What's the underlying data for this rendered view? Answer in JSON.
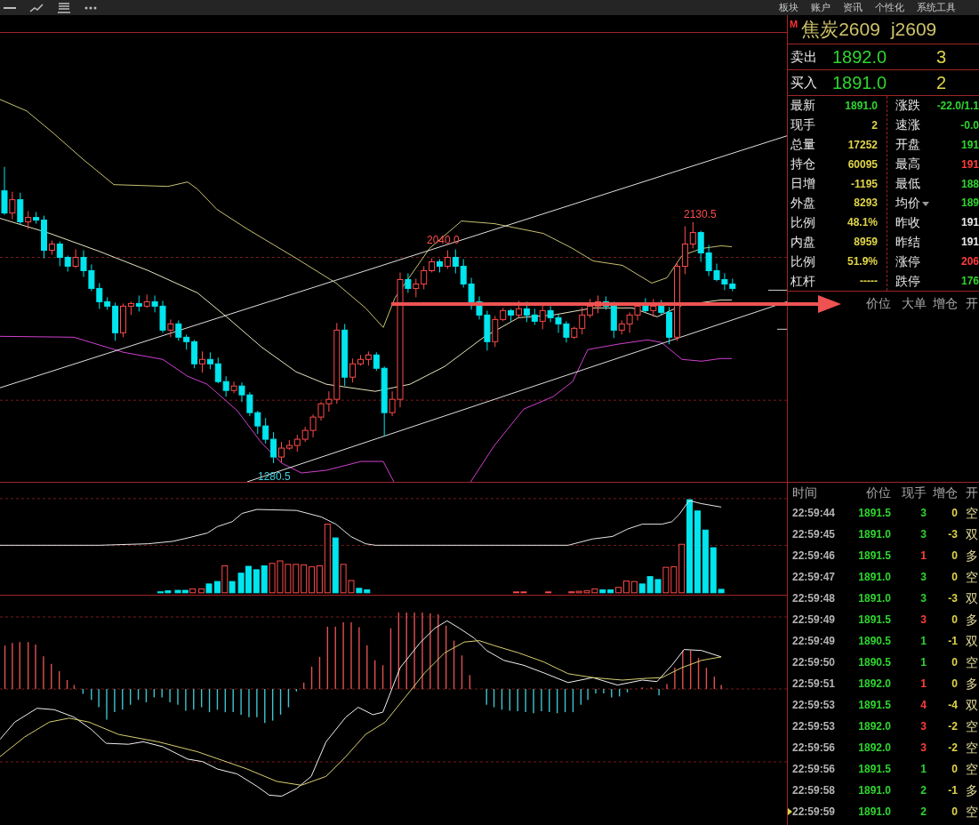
{
  "toolbar": {
    "menu_items": [
      "板块",
      "账户",
      "资讯",
      "个性化",
      "系统工具"
    ]
  },
  "chart": {
    "price_labels": [
      {
        "text": "2130.5",
        "color": "#ff4d4d"
      },
      {
        "text": "2040.0",
        "color": "#ff4d4d"
      },
      {
        "text": "1280.5",
        "color": "#3fd0dc"
      }
    ]
  },
  "quote": {
    "badge": "M",
    "name": "焦炭2609",
    "code": "j2609",
    "ask": {
      "label": "卖出",
      "price": "1892.0",
      "volume": "3"
    },
    "bid": {
      "label": "买入",
      "price": "1891.0",
      "volume": "2"
    }
  },
  "stats": {
    "left": [
      {
        "label": "最新",
        "value": "1891.0",
        "color": "#2fd52f"
      },
      {
        "label": "现手",
        "value": "2",
        "color": "#e0d448"
      },
      {
        "label": "总量",
        "value": "17252",
        "color": "#e0d448"
      },
      {
        "label": "持仓",
        "value": "60095",
        "color": "#e0d448"
      },
      {
        "label": "日增",
        "value": "-1195",
        "color": "#e0d448"
      },
      {
        "label": "外盘",
        "value": "8293",
        "color": "#e0d448"
      },
      {
        "label": "比例",
        "value": "48.1%",
        "color": "#e0d448"
      },
      {
        "label": "内盘",
        "value": "8959",
        "color": "#e0d448"
      },
      {
        "label": "比例",
        "value": "51.9%",
        "color": "#e0d448"
      },
      {
        "label": "杠杆",
        "value": "-----",
        "color": "#e0d448"
      }
    ],
    "right": [
      {
        "label": "涨跌",
        "value": "-22.0/1.1",
        "color": "#2fd52f",
        "dropdown": false
      },
      {
        "label": "速涨",
        "value": "-0.0",
        "color": "#2fd52f",
        "dropdown": false
      },
      {
        "label": "开盘",
        "value": "191",
        "color": "#2fd52f",
        "dropdown": false
      },
      {
        "label": "最高",
        "value": "191",
        "color": "#ff3c3c",
        "dropdown": false
      },
      {
        "label": "最低",
        "value": "188",
        "color": "#2fd52f",
        "dropdown": false
      },
      {
        "label": "均价",
        "value": "189",
        "color": "#2fd52f",
        "dropdown": true
      },
      {
        "label": "昨收",
        "value": "191",
        "color": "#e8e8e8",
        "dropdown": false
      },
      {
        "label": "昨结",
        "value": "191",
        "color": "#e8e8e8",
        "dropdown": false
      },
      {
        "label": "涨停",
        "value": "206",
        "color": "#ff3c3c",
        "dropdown": false
      },
      {
        "label": "跌停",
        "value": "176",
        "color": "#2fd52f",
        "dropdown": false
      }
    ]
  },
  "big_orders": {
    "columns": [
      "价位",
      "大单",
      "增仓",
      "开"
    ]
  },
  "ticks": {
    "columns": [
      "时间",
      "价位",
      "现手",
      "增仓",
      "开"
    ],
    "rows": [
      {
        "time": "22:59:44",
        "price": "1891.5",
        "volume": "3",
        "color": "#2fd52f",
        "change": "0",
        "type": "空",
        "selected": false
      },
      {
        "time": "22:59:45",
        "price": "1891.0",
        "volume": "3",
        "color": "#2fd52f",
        "change": "-3",
        "type": "双",
        "selected": false
      },
      {
        "time": "22:59:46",
        "price": "1891.5",
        "volume": "1",
        "color": "#ff3c3c",
        "change": "0",
        "type": "多",
        "selected": false
      },
      {
        "time": "22:59:47",
        "price": "1891.0",
        "volume": "3",
        "color": "#2fd52f",
        "change": "0",
        "type": "空",
        "selected": false
      },
      {
        "time": "22:59:48",
        "price": "1891.0",
        "volume": "3",
        "color": "#2fd52f",
        "change": "-3",
        "type": "双",
        "selected": false
      },
      {
        "time": "22:59:49",
        "price": "1891.5",
        "volume": "3",
        "color": "#ff3c3c",
        "change": "0",
        "type": "多",
        "selected": false
      },
      {
        "time": "22:59:49",
        "price": "1890.5",
        "volume": "1",
        "color": "#2fd52f",
        "change": "-1",
        "type": "双",
        "selected": false
      },
      {
        "time": "22:59:50",
        "price": "1890.5",
        "volume": "1",
        "color": "#2fd52f",
        "change": "0",
        "type": "空",
        "selected": false
      },
      {
        "time": "22:59:51",
        "price": "1892.0",
        "volume": "1",
        "color": "#ff3c3c",
        "change": "0",
        "type": "多",
        "selected": false
      },
      {
        "time": "22:59:53",
        "price": "1891.5",
        "volume": "4",
        "color": "#ff3c3c",
        "change": "-4",
        "type": "双",
        "selected": false
      },
      {
        "time": "22:59:53",
        "price": "1892.0",
        "volume": "3",
        "color": "#ff3c3c",
        "change": "-2",
        "type": "空",
        "selected": false
      },
      {
        "time": "22:59:56",
        "price": "1892.0",
        "volume": "3",
        "color": "#ff3c3c",
        "change": "-2",
        "type": "空",
        "selected": false
      },
      {
        "time": "22:59:56",
        "price": "1891.5",
        "volume": "1",
        "color": "#2fd52f",
        "change": "0",
        "type": "空",
        "selected": false
      },
      {
        "time": "22:59:58",
        "price": "1891.0",
        "volume": "2",
        "color": "#2fd52f",
        "change": "-1",
        "type": "多",
        "selected": false
      },
      {
        "time": "22:59:59",
        "price": "1891.0",
        "volume": "2",
        "color": "#2fd52f",
        "change": "0",
        "type": "空",
        "selected": true
      }
    ]
  }
}
